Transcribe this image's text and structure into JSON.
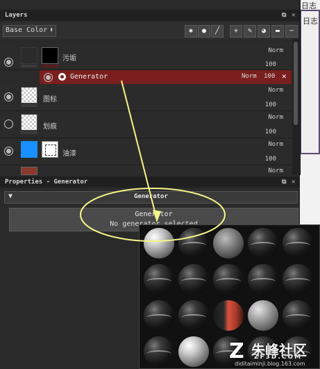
{
  "header_text_1": "日志",
  "header_text_2": "日志",
  "layers": {
    "title": "Layers",
    "channel": "Base Color",
    "rows": [
      {
        "name": "污垢",
        "blend": "Norm",
        "opacity": "100",
        "visible": true
      },
      {
        "name": "图标",
        "blend": "Norm",
        "opacity": "100",
        "visible": true
      },
      {
        "name": "划痕",
        "blend": "Norm",
        "opacity": "100",
        "visible": false
      },
      {
        "name": "油漆",
        "blend": "Norm",
        "opacity": "100",
        "visible": true
      },
      {
        "name": "",
        "blend": "Norm",
        "opacity": "",
        "visible": true
      }
    ],
    "generator": {
      "name": "Generator",
      "blend": "Norm",
      "opacity": "100",
      "close": "✕"
    }
  },
  "properties": {
    "title": "Properties - Generator",
    "section": "Generator",
    "button_title": "Generator",
    "button_status": "No generator selected"
  },
  "watermark": {
    "brand": "朱峰社区",
    "domain": "ZF3D.COM",
    "blog": "diditaiminji.blog.163.com"
  },
  "colors": {
    "selected_row": "#7a1e1e",
    "blue_layer": "#1890ff",
    "annotation": "#f5f58a"
  }
}
